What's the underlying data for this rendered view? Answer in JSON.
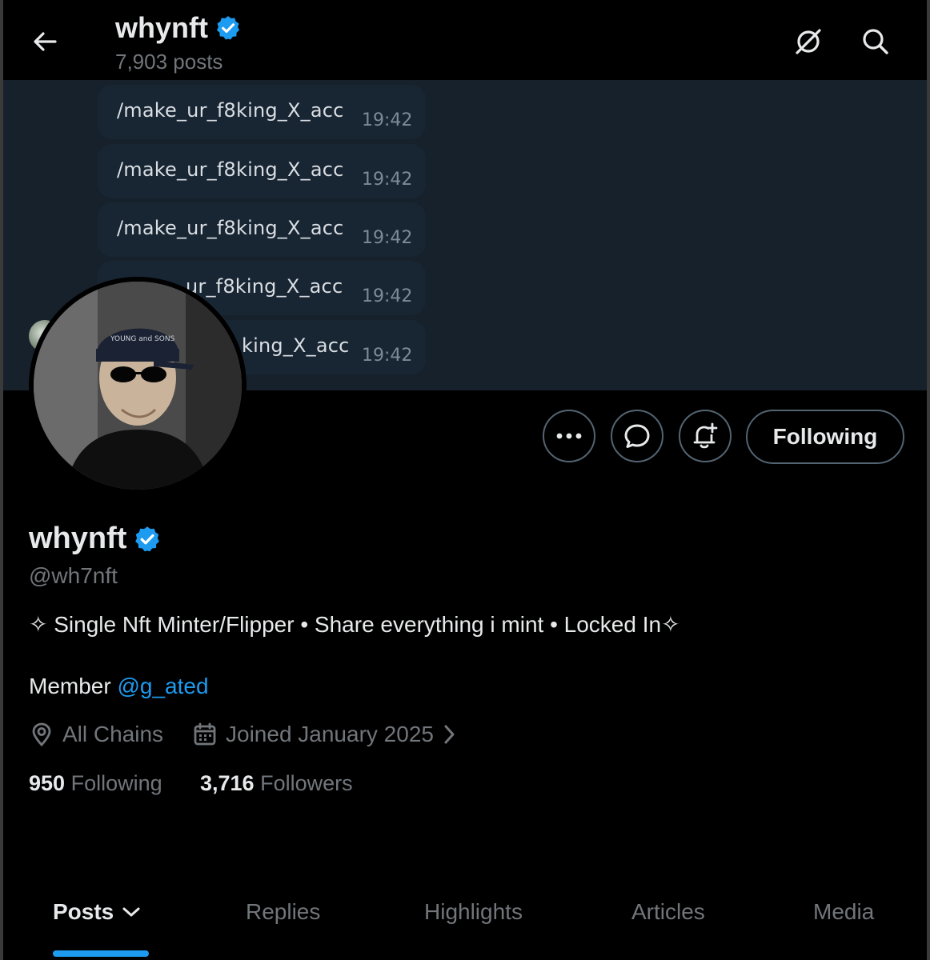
{
  "header": {
    "title": "whynft",
    "posts_count": "7,903 posts"
  },
  "banner": {
    "messages": [
      {
        "text": "/make_ur_f8king_X_acc",
        "time": "19:42"
      },
      {
        "text": "/make_ur_f8king_X_acc",
        "time": "19:42"
      },
      {
        "text": "/make_ur_f8king_X_acc",
        "time": "19:42"
      },
      {
        "text": "ur_f8king_X_acc",
        "time": "19:42"
      },
      {
        "text": "king_X_acc",
        "time": "19:42"
      }
    ]
  },
  "actions": {
    "following_label": "Following"
  },
  "profile": {
    "name": "whynft",
    "handle": "@wh7nft",
    "bio": "✧ Single Nft Minter/Flipper • Share everything i mint • Locked In✧",
    "member_prefix": "Member",
    "member_link": "@g_ated",
    "location": "All Chains",
    "joined": "Joined January 2025",
    "following_count": "950",
    "following_label": "Following",
    "followers_count": "3,716",
    "followers_label": "Followers"
  },
  "tabs": [
    {
      "label": "Posts",
      "active": true
    },
    {
      "label": "Replies",
      "active": false
    },
    {
      "label": "Highlights",
      "active": false
    },
    {
      "label": "Articles",
      "active": false
    },
    {
      "label": "Media",
      "active": false
    }
  ],
  "colors": {
    "accent": "#1d9bf0",
    "background": "#000000",
    "banner": "#17212b",
    "muted_text": "#71767b",
    "border": "#536471"
  },
  "icons": [
    "back-arrow-icon",
    "verified-badge-icon",
    "grok-icon",
    "search-icon",
    "more-icon",
    "message-icon",
    "notification-bell-icon",
    "location-icon",
    "calendar-icon",
    "chevron-right-icon",
    "chevron-down-icon"
  ]
}
